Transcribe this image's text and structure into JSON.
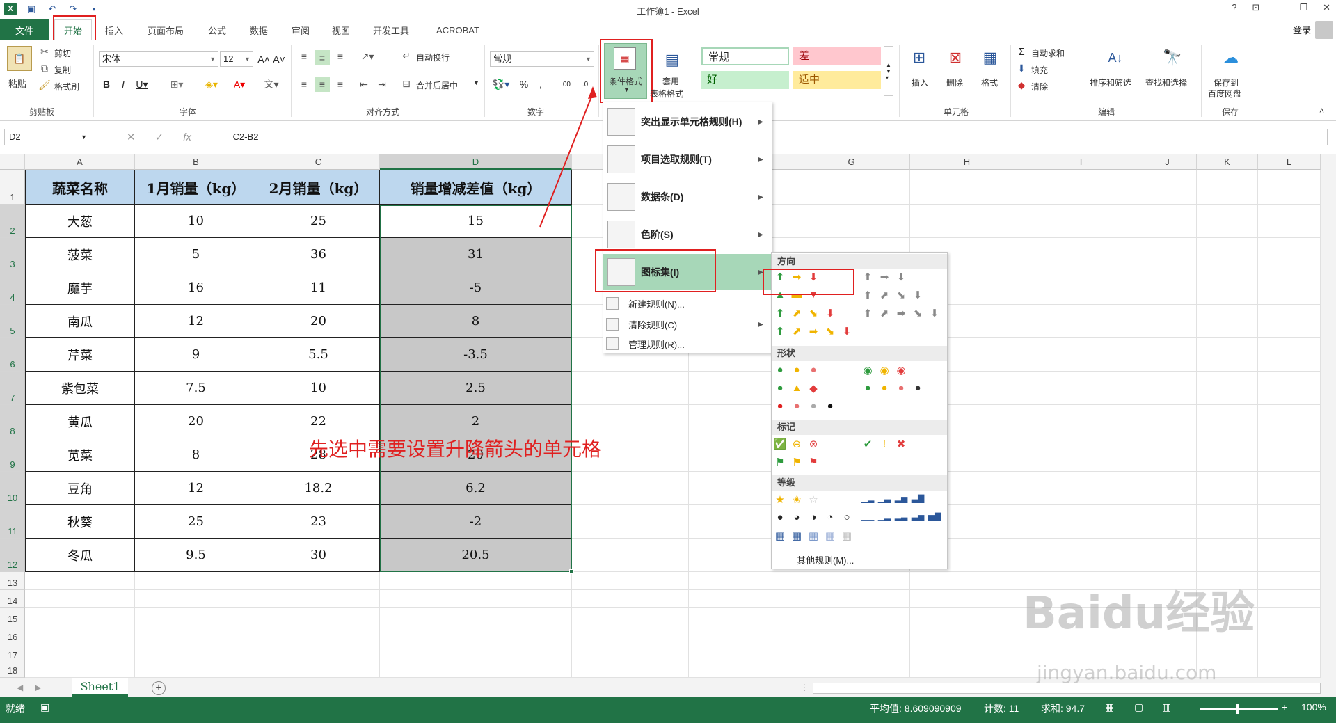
{
  "window": {
    "title": "工作簿1 - Excel",
    "help": "?",
    "login": "登录"
  },
  "tabs": [
    "文件",
    "开始",
    "插入",
    "页面布局",
    "公式",
    "数据",
    "审阅",
    "视图",
    "开发工具",
    "ACROBAT"
  ],
  "ribbon": {
    "clipboard": {
      "paste": "粘贴",
      "cut": "剪切",
      "copy": "复制",
      "format_painter": "格式刷",
      "label": "剪贴板"
    },
    "font": {
      "name": "宋体",
      "size": "12",
      "label": "字体"
    },
    "align": {
      "wrap": "自动换行",
      "merge": "合并后居中",
      "label": "对齐方式"
    },
    "number": {
      "format": "常规",
      "label": "数字"
    },
    "styles": {
      "cond_format": "条件格式",
      "table_format_1": "套用",
      "table_format_2": "表格格式",
      "normal": "常规",
      "bad": "差",
      "good": "好",
      "neutral": "适中"
    },
    "cells": {
      "insert": "插入",
      "delete": "删除",
      "format": "格式",
      "label": "单元格"
    },
    "editing": {
      "autosum": "自动求和",
      "fill": "填充",
      "clear": "清除",
      "sort": "排序和筛选",
      "find": "查找和选择",
      "label": "编辑"
    },
    "save": {
      "save_to": "保存到",
      "baidu": "百度网盘",
      "label": "保存"
    }
  },
  "formula_bar": {
    "name_box": "D2",
    "formula": "=C2-B2"
  },
  "columns": [
    "A",
    "B",
    "C",
    "D",
    "E",
    "F",
    "G",
    "H",
    "I",
    "J",
    "K",
    "L"
  ],
  "rows": [
    "1",
    "2",
    "3",
    "4",
    "5",
    "6",
    "7",
    "8",
    "9",
    "10",
    "11",
    "12",
    "13",
    "14",
    "15",
    "16",
    "17",
    "18"
  ],
  "table": {
    "headers": [
      "蔬菜名称",
      "1月销量（kg）",
      "2月销量（kg）",
      "销量增减差值（kg）"
    ],
    "rows": [
      [
        "大葱",
        "10",
        "25",
        "15"
      ],
      [
        "菠菜",
        "5",
        "36",
        "31"
      ],
      [
        "魔芋",
        "16",
        "11",
        "-5"
      ],
      [
        "南瓜",
        "12",
        "20",
        "8"
      ],
      [
        "芹菜",
        "9",
        "5.5",
        "-3.5"
      ],
      [
        "紫包菜",
        "7.5",
        "10",
        "2.5"
      ],
      [
        "黄瓜",
        "20",
        "22",
        "2"
      ],
      [
        "苋菜",
        "8",
        "28",
        "20"
      ],
      [
        "豆角",
        "12",
        "18.2",
        "6.2"
      ],
      [
        "秋葵",
        "25",
        "23",
        "-2"
      ],
      [
        "冬瓜",
        "9.5",
        "30",
        "20.5"
      ]
    ]
  },
  "annotation": "先选中需要设置升降箭头的单元格",
  "cf_menu": {
    "highlight": "突出显示单元格规则(H)",
    "topbottom": "项目选取规则(T)",
    "databar": "数据条(D)",
    "colorscale": "色阶(S)",
    "iconset": "图标集(I)",
    "new_rule": "新建规则(N)...",
    "clear_rule": "清除规则(C)",
    "manage_rule": "管理规则(R)..."
  },
  "iconset_menu": {
    "directional": "方向",
    "shapes": "形状",
    "indicators": "标记",
    "ratings": "等级",
    "more_rules": "其他规则(M)..."
  },
  "sheet": {
    "tab": "Sheet1"
  },
  "status": {
    "ready": "就绪",
    "average": "平均值: 8.609090909",
    "count": "计数: 11",
    "sum": "求和: 94.7",
    "zoom": "100%"
  },
  "watermark": {
    "main": "Baidu经验",
    "sub": "jingyan.baidu.com"
  },
  "colors": {
    "excel_green": "#217346",
    "header_blue": "#bdd7ee",
    "highlight_red": "#e02020",
    "menu_highlight": "#a7d7b8"
  }
}
